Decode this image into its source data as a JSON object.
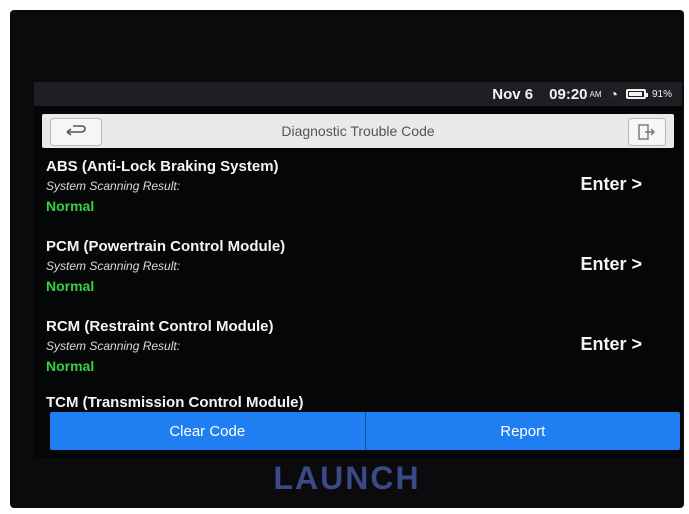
{
  "status_bar": {
    "date": "Nov 6",
    "time": "09:20",
    "ampm": "AM",
    "battery": "91%",
    "battery_level": 0.91
  },
  "header": {
    "title": "Diagnostic Trouble Code",
    "back_icon": "back-arrow-icon",
    "exit_icon": "exit-icon"
  },
  "modules": [
    {
      "name": "ABS (Anti-Lock Braking System)",
      "label": "System Scanning Result:",
      "status": "Normal",
      "action": "Enter >"
    },
    {
      "name": "PCM (Powertrain Control Module)",
      "label": "System Scanning Result:",
      "status": "Normal",
      "action": "Enter >"
    },
    {
      "name": "RCM (Restraint Control Module)",
      "label": "System Scanning Result:",
      "status": "Normal",
      "action": "Enter >"
    },
    {
      "name": "TCM (Transmission Control Module)"
    }
  ],
  "footer": {
    "clear_code": "Clear Code",
    "report": "Report"
  },
  "brand": "LAUNCH",
  "colors": {
    "accent": "#1f7ff0",
    "normal": "#34d23c",
    "background": "#050608"
  }
}
